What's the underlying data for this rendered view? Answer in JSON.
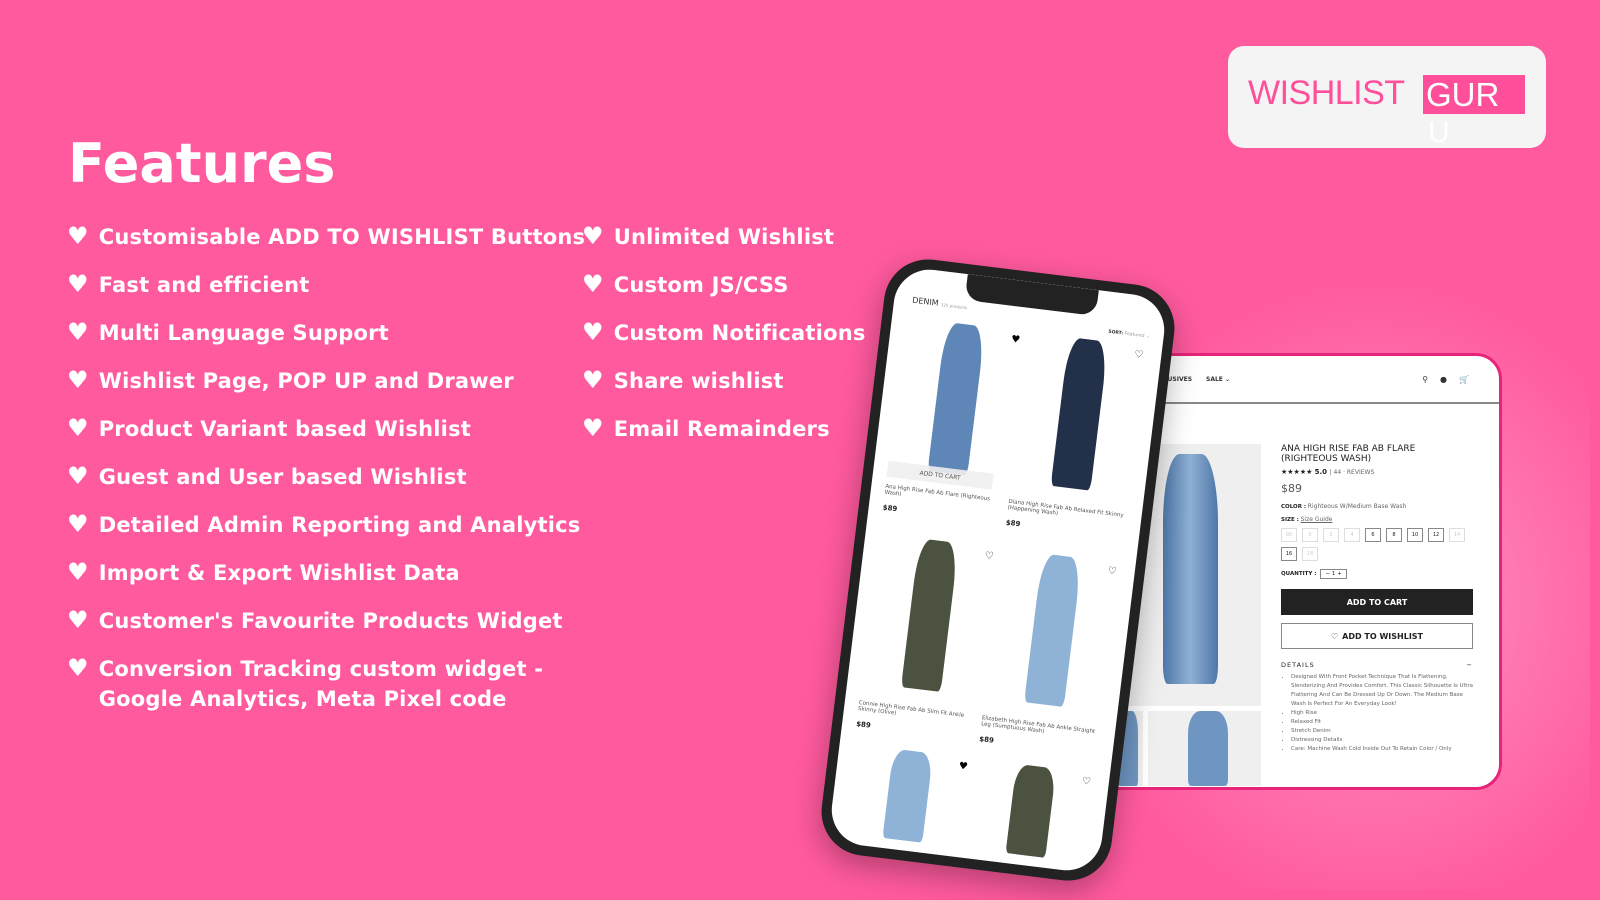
{
  "title": "Features",
  "features_left": [
    "Customisable ADD TO WISHLIST Buttons",
    "Fast and efficient",
    "Multi Language Support",
    "Wishlist Page, POP UP and Drawer",
    "Product Variant based Wishlist",
    "Guest and User based Wishlist",
    "Detailed Admin Reporting and Analytics",
    "Import & Export Wishlist Data",
    "Customer's Favourite Products Widget",
    "Conversion Tracking custom widget -\nGoogle Analytics, Meta Pixel code"
  ],
  "features_right": [
    "Unlimited Wishlist",
    "Custom JS/CSS",
    "Custom Notifications",
    "Share wishlist",
    "Email Remainders"
  ],
  "logo": {
    "wishlist": "WISHLIST",
    "gur": "GUR",
    "u": "U"
  },
  "colors": {
    "background": "#ff5a9e",
    "brand": "#ff4f9b"
  },
  "desktop": {
    "nav": [
      "EXCLUSIVES",
      "SALE ⌄"
    ],
    "product_title": "ANA HIGH RISE FAB AB FLARE (RIGHTEOUS WASH)",
    "rating": "5.0",
    "reviews": "44 · REVIEWS",
    "price": "$89",
    "color_label": "COLOR :",
    "color_value": "Righteous W/Medium Base Wash",
    "size_label": "SIZE :",
    "size_guide": "Size Guide",
    "sizes": [
      "00",
      "0",
      "2",
      "4",
      "6",
      "8",
      "10",
      "12",
      "14",
      "16",
      "18"
    ],
    "quantity_label": "QUANTITY :",
    "quantity": "1",
    "add_to_cart": "ADD TO CART",
    "add_to_wishlist": "ADD TO WISHLIST",
    "details_label": "DETAILS",
    "details": [
      "Designed With Front Pocket Technique That Is Flattening, Slenderizing And Provides Comfort. This Classic Silhouette Is Ultra Flattering And Can Be Dressed Up Or Down. The Medium Base Wash Is Perfect For An Everyday Look!",
      "High Rise",
      "Relaxed Fit",
      "Stretch Denim",
      "Distressing Details",
      "Care: Machine Wash Cold Inside Out To Retain Color / Only"
    ]
  },
  "phone": {
    "collection": "DENIM",
    "count": "125 products",
    "sort_label": "SORT:",
    "sort_value": "Featured ⌄",
    "add_to_cart": "ADD TO CART",
    "products": [
      {
        "name": "Ana High Rise Fab Ab Flare (Righteous Wash)",
        "price": "$89"
      },
      {
        "name": "Diana High Rise Fab Ab Relaxed Fit Skinny (Happening Wash)",
        "price": "$89"
      },
      {
        "name": "Connie High Rise Fab Ab Slim Fit Ankle Skinny (Olive)",
        "price": "$89"
      },
      {
        "name": "Elizabeth High Rise Fab Ab Ankle Straight Leg (Sumptuous Wash)",
        "price": "$89"
      }
    ]
  }
}
